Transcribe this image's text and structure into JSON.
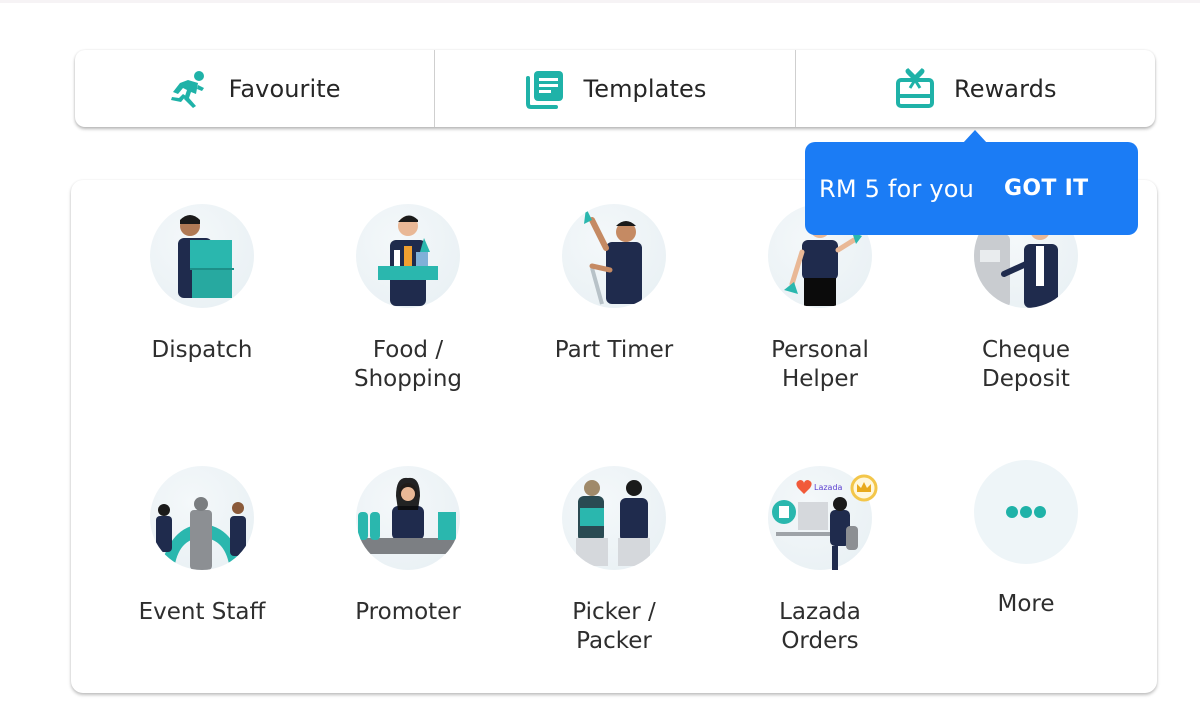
{
  "tabs": [
    {
      "label": "Favourite",
      "icon": "running-person-icon"
    },
    {
      "label": "Templates",
      "icon": "templates-icon"
    },
    {
      "label": "Rewards",
      "icon": "gift-card-icon"
    }
  ],
  "tooltip": {
    "text": "RM 5 for you",
    "button": "GOT IT"
  },
  "services": [
    {
      "label": "Dispatch",
      "icon": "dispatch-icon"
    },
    {
      "label": "Food /\nShopping",
      "icon": "food-shopping-icon"
    },
    {
      "label": "Part Timer",
      "icon": "part-timer-icon"
    },
    {
      "label": "Personal\nHelper",
      "icon": "personal-helper-icon"
    },
    {
      "label": "Cheque\nDeposit",
      "icon": "cheque-deposit-icon"
    },
    {
      "label": "Event Staff",
      "icon": "event-staff-icon"
    },
    {
      "label": "Promoter",
      "icon": "promoter-icon"
    },
    {
      "label": "Picker /\nPacker",
      "icon": "picker-packer-icon"
    },
    {
      "label": "Lazada\nOrders",
      "icon": "lazada-orders-icon",
      "brand_text": "Lazada"
    },
    {
      "label": "More",
      "icon": "more-icon"
    }
  ],
  "colors": {
    "accent": "#1fb2a8",
    "tooltip_bg": "#1b7cf5",
    "navy": "#1f2b4d"
  }
}
